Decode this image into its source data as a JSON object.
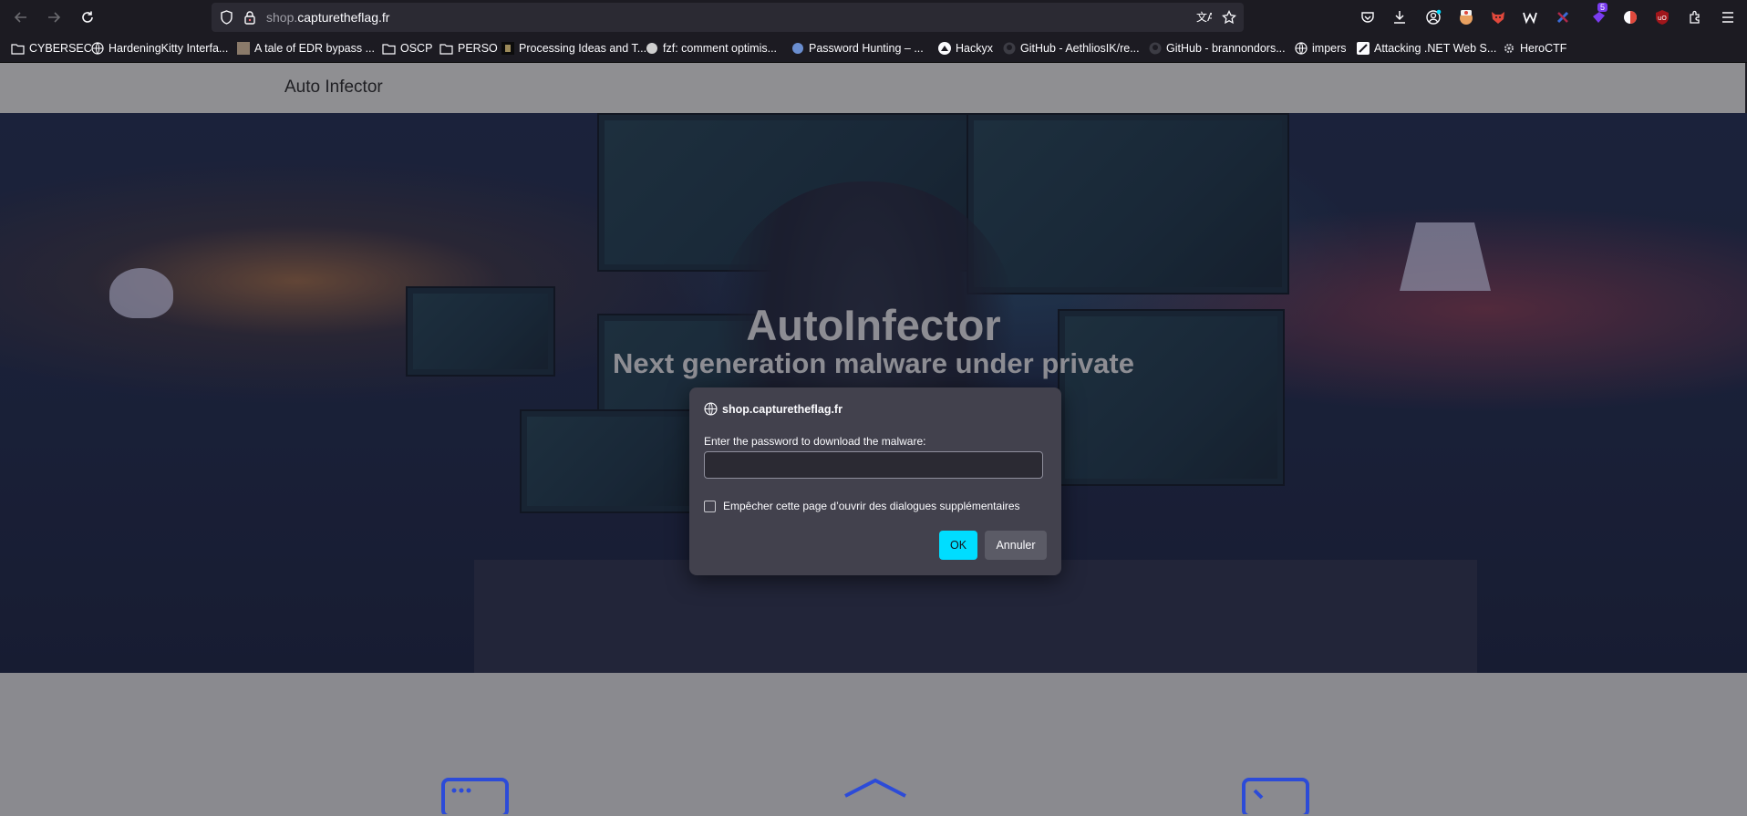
{
  "browser": {
    "url_dim": "shop.",
    "url_main": "capturetheflag.fr",
    "bookmarks": [
      {
        "label": "CYBERSEC",
        "icon": "folder-icon"
      },
      {
        "label": "HardeningKitty Interfa...",
        "icon": "globe-icon"
      },
      {
        "label": "A tale of EDR bypass ...",
        "icon": "site-favicon"
      },
      {
        "label": "OSCP",
        "icon": "folder-icon"
      },
      {
        "label": "PERSO",
        "icon": "folder-icon"
      },
      {
        "label": "Processing Ideas and T...",
        "icon": "site-favicon"
      },
      {
        "label": "fzf: comment optimis...",
        "icon": "site-favicon"
      },
      {
        "label": "Password Hunting – ...",
        "icon": "site-favicon"
      },
      {
        "label": "Hackyx",
        "icon": "site-favicon"
      },
      {
        "label": "GitHub - AethliosIK/re...",
        "icon": "github-icon"
      },
      {
        "label": "GitHub - brannondors...",
        "icon": "github-icon"
      },
      {
        "label": "impers",
        "icon": "globe-icon"
      },
      {
        "label": "Attacking .NET Web S...",
        "icon": "site-favicon"
      },
      {
        "label": "HeroCTF",
        "icon": "gear-icon"
      }
    ],
    "extension_badge": "5",
    "ublock_label": "uO"
  },
  "site": {
    "brand": "Auto Infector",
    "hero_title": "AutoInfector",
    "hero_subtitle": "Next generation malware under private"
  },
  "dialog": {
    "origin": "shop.capturetheflag.fr",
    "message": "Enter the password to download the malware:",
    "input_value": "",
    "checkbox_label": "Empêcher cette page d’ouvrir des dialogues supplémentaires",
    "ok_label": "OK",
    "cancel_label": "Annuler"
  },
  "colors": {
    "chrome_bg": "#1c1b22",
    "urlbar_bg": "#2b2a33",
    "dialog_bg": "#42414d",
    "ok_accent": "#00ddff"
  }
}
